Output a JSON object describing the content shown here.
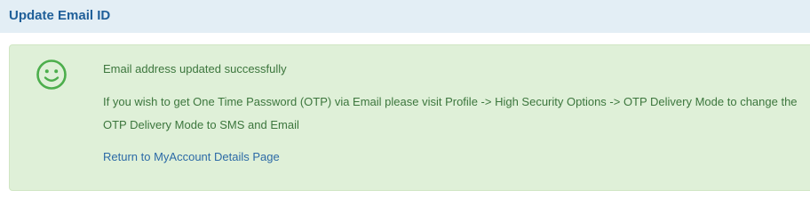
{
  "header": {
    "title": "Update Email ID"
  },
  "alert": {
    "icon": "smiley-icon",
    "message": "Email address updated successfully",
    "otp_info": "If you wish to get One Time Password (OTP) via Email please visit Profile -> High Security Options -> OTP Delivery Mode to change the OTP Delivery Mode to SMS and Email",
    "return_link": "Return to MyAccount Details Page"
  },
  "colors": {
    "header_bg": "#e3eef5",
    "title": "#1f5f99",
    "panel_bg": "#dff0d8",
    "success_text": "#3c763d",
    "icon": "#4cae4c",
    "link": "#2c6aa6"
  }
}
